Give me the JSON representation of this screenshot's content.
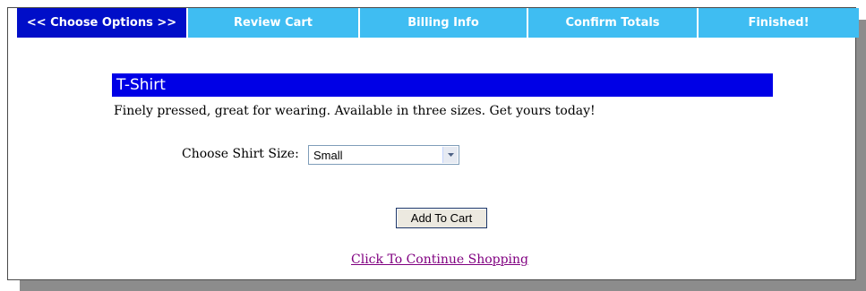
{
  "steps": [
    {
      "label": "<< Choose Options >>",
      "active": true
    },
    {
      "label": "Review Cart",
      "active": false
    },
    {
      "label": "Billing Info",
      "active": false
    },
    {
      "label": "Confirm Totals",
      "active": false
    },
    {
      "label": "Finished!",
      "active": false
    }
  ],
  "colors": {
    "step_active": "#000ec8",
    "step_inactive": "#3fbdf2",
    "title_bar": "#0000e6",
    "link_visited": "#800080"
  },
  "product": {
    "title": "T-Shirt",
    "description": "Finely pressed, great for wearing. Available in three sizes. Get yours today!"
  },
  "size": {
    "label": "Choose Shirt Size:",
    "selected": "Small",
    "icon": "dropdown-arrow-icon"
  },
  "actions": {
    "add_to_cart": "Add To Cart",
    "continue_shopping": "Click To Continue Shopping"
  }
}
